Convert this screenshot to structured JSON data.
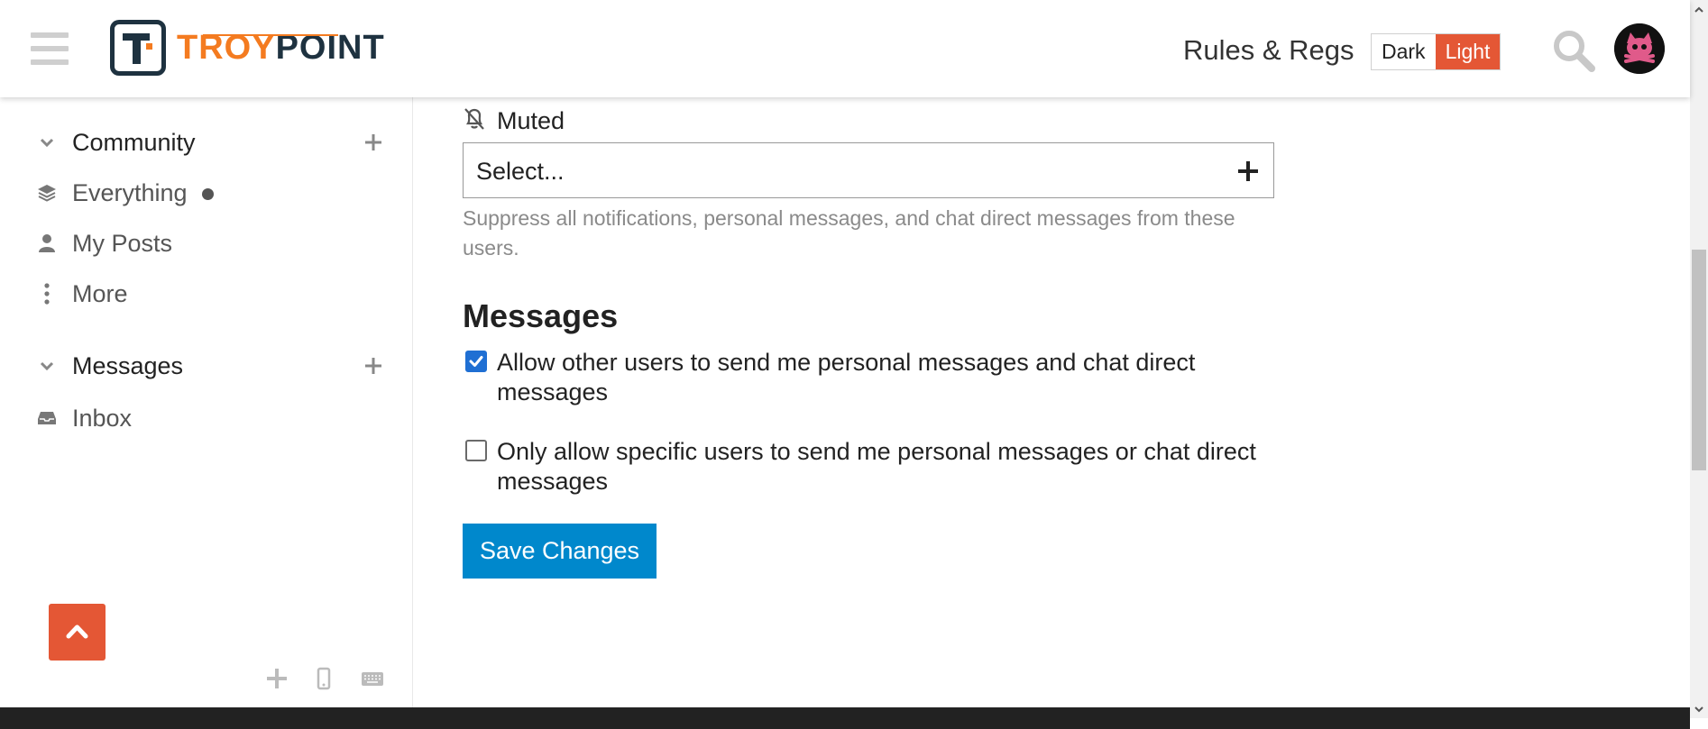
{
  "header": {
    "logo_text_troy": "TROY",
    "logo_text_point": "POINT",
    "link_rules": "Rules & Regs",
    "theme_dark": "Dark",
    "theme_light": "Light",
    "accent_color": "#e45735"
  },
  "sidebar": {
    "sections": [
      {
        "title": "Community",
        "items": [
          {
            "label": "Everything",
            "icon": "layers-icon",
            "unread_dot": true
          },
          {
            "label": "My Posts",
            "icon": "user-icon"
          },
          {
            "label": "More",
            "icon": "vertical-ellipsis-icon"
          }
        ]
      },
      {
        "title": "Messages",
        "items": [
          {
            "label": "Inbox",
            "icon": "inbox-icon"
          }
        ]
      }
    ]
  },
  "main": {
    "muted": {
      "label": "Muted",
      "select_placeholder": "Select...",
      "help": "Suppress all notifications, personal messages, and chat direct messages from these users."
    },
    "messages": {
      "title": "Messages",
      "options": [
        {
          "label": "Allow other users to send me personal messages and chat direct messages",
          "checked": true
        },
        {
          "label": "Only allow specific users to send me personal messages or chat direct messages",
          "checked": false
        }
      ]
    },
    "save_label": "Save Changes"
  },
  "colors": {
    "primary_button": "#0088cc",
    "checkbox_checked": "#1f6fd3"
  }
}
